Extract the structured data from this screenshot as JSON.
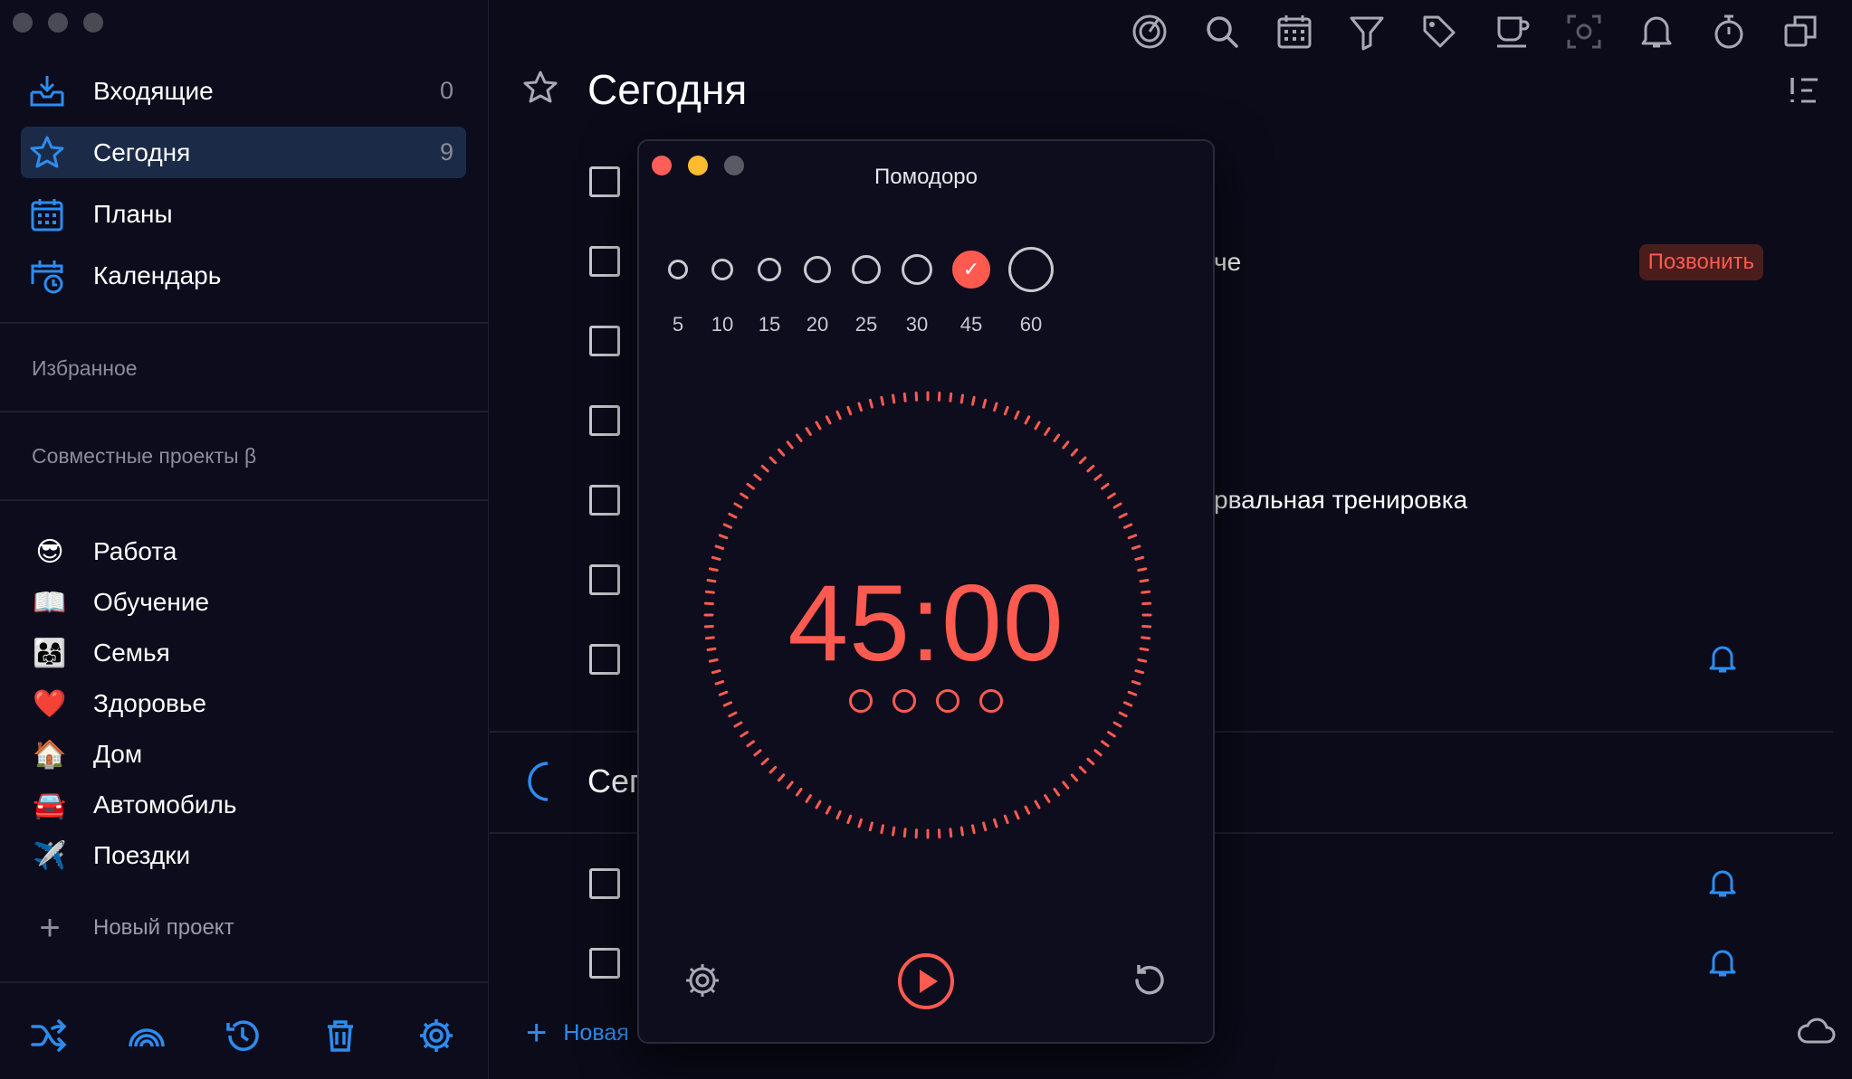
{
  "colors": {
    "accent_blue": "#2d8cf0",
    "accent_red": "#ff5a4f",
    "bg": "#0b0b1a",
    "active_bg": "#1b2b47"
  },
  "sidebar": {
    "nav": [
      {
        "label": "Входящие",
        "count": "0",
        "icon": "inbox-icon"
      },
      {
        "label": "Сегодня",
        "count": "9",
        "icon": "star-icon",
        "active": true
      },
      {
        "label": "Планы",
        "count": "",
        "icon": "calendar-grid-icon"
      },
      {
        "label": "Календарь",
        "count": "",
        "icon": "calendar-clock-icon"
      }
    ],
    "favorites_label": "Избранное",
    "shared_label": "Совместные проекты β",
    "projects": [
      {
        "emoji": "😎",
        "label": "Работа"
      },
      {
        "emoji": "📖",
        "label": "Обучение"
      },
      {
        "emoji": "👨‍👩‍👧",
        "label": "Семья"
      },
      {
        "emoji": "❤️",
        "label": "Здоровье"
      },
      {
        "emoji": "🏠",
        "label": "Дом"
      },
      {
        "emoji": "🚘",
        "label": "Автомобиль"
      },
      {
        "emoji": "✈️",
        "label": "Поездки"
      }
    ],
    "new_project_label": "Новый проект"
  },
  "main": {
    "title": "Сегодня",
    "tasks": [
      {
        "text": "че"
      },
      {
        "text": "рвальная тренировка"
      }
    ],
    "badge": "Позвонить",
    "evening_title_partial": "Сег",
    "new_task_label": "Новая"
  },
  "pomodoro": {
    "title": "Помодоро",
    "presets": [
      "5",
      "10",
      "15",
      "20",
      "25",
      "30",
      "45",
      "60"
    ],
    "active_preset": "45",
    "timer": "45:00",
    "sessions": 4
  }
}
